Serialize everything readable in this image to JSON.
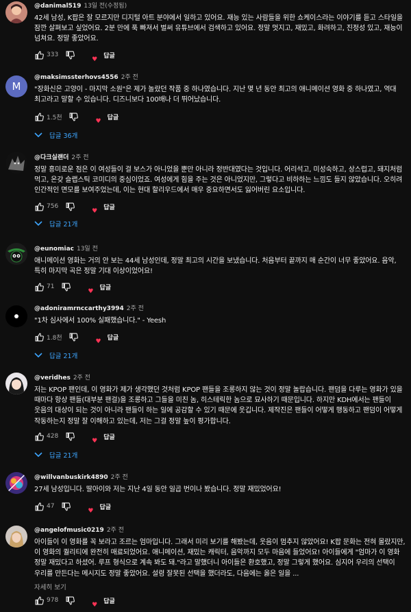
{
  "colors": {
    "background": "#0f0f0f",
    "text": "#f1f1f1",
    "secondary": "#aaaaaa",
    "link": "#3ea6ff",
    "heart": "#ff3355"
  },
  "reply_label": "답글",
  "comments": [
    {
      "author": "@danimal519",
      "time": "13일 전(수정됨)",
      "text": "42세 남성, K팝은 잘 모르지만 디지털 아트 분야에서 일하고 있어요. 재능 있는 사람들을 위한 쇼케이스라는 이야기를 듣고 스타일을 잠깐 살펴보고 싶었어요. 2분 만에 푹 빠져서 벌써 유튜브에서 검색하고 있어요. 정말 멋지고, 재밌고, 화려하고, 진정성 있고, 재능이 넘쳐요. 정말 좋았어요.",
      "likes": "333",
      "avatar_icon": "cartoon-portrait-icon",
      "replies": ""
    },
    {
      "author": "@maksimssterhovs4556",
      "time": "2주 전",
      "text": "\"장화신은 고양이 - 마지막 소원\"은 제가 놀랐던 작품 중 하나였습니다. 지난 몇 년 동안 최고의 애니메이션 영화 중 하나였고, 역대 최고라고 말할 수 있습니다. 디즈니보다 100배나 더 뛰어났습니다.",
      "likes": "1.5천",
      "avatar_letter": "M",
      "replies": "답글 36개"
    },
    {
      "author": "@다크실랜더",
      "time": "2주 전",
      "text": "정말 흥미로운 점은 이 여성들이 걸 보스가 아니었을 뿐만 아니라 정반대였다는 것입니다. 어리석고, 미성숙하고, 상스럽고, 돼지처럼 먹고, 온갖 슬랩스틱 코미디의 중심이었죠. 여성에게 힘을 주는 것은 아니었지만, 그렇다고 비하하는 느낌도 들지 않았습니다. 오히려 인간적인 면모를 보여주었는데, 이는 현대 할리우드에서 매우 중요하면서도 잃어버린 요소입니다.",
      "likes": "756",
      "avatar_icon": "dark-creature-icon",
      "replies": "답글 21개"
    },
    {
      "author": "@eunomiac",
      "time": "13일 전",
      "text": "애니메이션 영화는 거의 안 보는 44세 남성인데, 정말 최고의 시간을 보냈습니다. 처음부터 끝까지 매 순간이 너무 좋았어요. 음악, 특히 마지막 곡은 정말 기대 이상이었어요!",
      "likes": "71",
      "avatar_icon": "martian-cartoon-icon",
      "replies": ""
    },
    {
      "author": "@adoniramrnccarthy3994",
      "time": "2주 전",
      "text": "\"1차 심사에서 100% 실패했습니다.\" - Yeesh",
      "likes": "1.8천",
      "avatar_icon": "white-dot-icon",
      "replies": "답글 21개"
    },
    {
      "author": "@veridhes",
      "time": "2주 전",
      "text": "저는 KPOP 팬인데, 이 영화가 제가 생각했던 것처럼 KPOP 팬들을 조롱하지 않는 것이 정말 놀랍습니다. 팬덤을 다루는 영화가 있을 때마다 항상 팬들(대부분 팬걸)을 조롱하고 그들을 미친 놈, 히스테릭한 놈으로 묘사하기 때문입니다. 하지만 KDH에서는 팬들이 웃음의 대상이 되는 것이 아니라 팬들이 하는 일에 공감할 수 있기 때문에 웃깁니다. 제작진은 팬들이 어떻게 행동하고 팬덤이 어떻게 작동하는지 정말 잘 이해하고 있는데, 저는 그걸 정말 높이 평가합니다.",
      "likes": "428",
      "avatar_icon": "anime-girl-icon",
      "replies": "답글 21개"
    },
    {
      "author": "@willvanbuskirk4890",
      "time": "2주 전",
      "text": "27세 남성입니다. 딸아이와 저는 지난 4일 동안 일곱 번이나 봤습니다. 정말 재밌었어요!",
      "likes": "47",
      "avatar_icon": "colorful-abstract-icon",
      "replies": ""
    },
    {
      "author": "@angelofmusic0219",
      "time": "2주 전",
      "text": "아이들이 이 영화를 꼭 보라고 조르는 엄마입니다. 그래서 미리 보기를 해봤는데, 웃음이 멈추지 않았어요! K팝 문화는 전혀 몰랐지만, 이 영화의 퀄리티에 완전히 매료되었어요. 애니메이션, 재밌는 캐릭터, 음악까지 모두 마음에 들었어요! 아이들에게 \"엄마가 이 영화 정말 재밌다고 하셨어. 루프 형식으로 계속 봐도 돼.\"라고 말했더니 아이들은 환호했고, 정말 그렇게 했어요. 심지어 우리의 선택이 우리를 만든다는 메시지도 정말 좋았어요. 설령 잘못된 선택을 했더라도, 다음에는 옳은 일을 ...",
      "more": "자세히 보기",
      "likes": "978",
      "avatar_icon": "woman-portrait-icon",
      "replies": ""
    }
  ]
}
